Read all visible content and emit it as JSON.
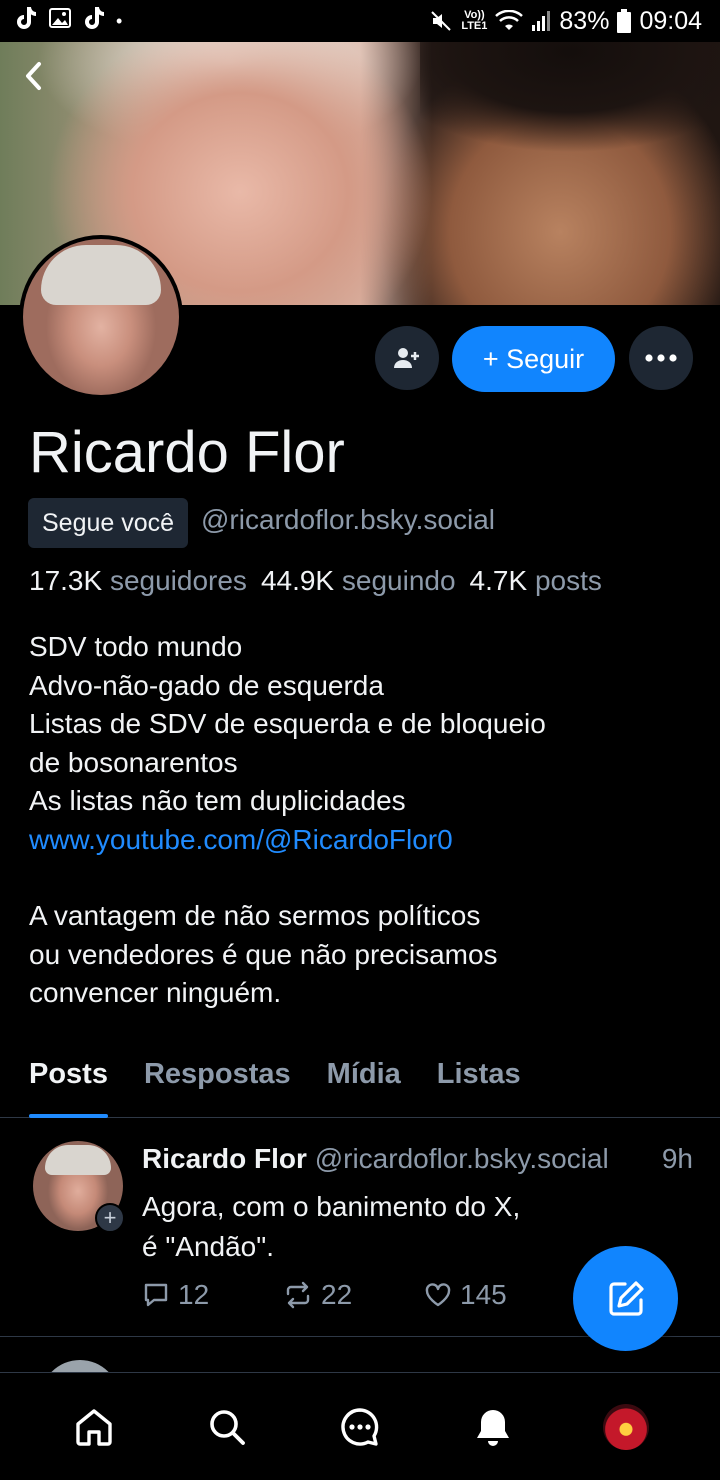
{
  "status_bar": {
    "volte_line1": "Vo))",
    "volte_line2": "LTE1",
    "battery": "83%",
    "time": "09:04"
  },
  "profile": {
    "display_name": "Ricardo Flor",
    "follows_you_badge": "Segue você",
    "handle": "@ricardoflor.bsky.social",
    "follow_button": "+ Seguir",
    "stats": {
      "followers_count": "17.3K",
      "followers_label": "seguidores",
      "following_count": "44.9K",
      "following_label": "seguindo",
      "posts_count": "4.7K",
      "posts_label": "posts"
    },
    "bio": {
      "line1": "SDV todo mundo",
      "line2": "Advo-não-gado de esquerda",
      "line3": "Listas de SDV de esquerda e de bloqueio",
      "line4": "de bosonarentos",
      "line5": "As listas não tem duplicidades",
      "link": "www.youtube.com/@RicardoFlor0",
      "para2_line1": "A vantagem de não sermos políticos",
      "para2_line2": "ou vendedores é que não precisamos",
      "para2_line3": "convencer ninguém."
    }
  },
  "tabs": [
    {
      "label": "Posts",
      "active": true
    },
    {
      "label": "Respostas",
      "active": false
    },
    {
      "label": "Mídia",
      "active": false
    },
    {
      "label": "Listas",
      "active": false
    }
  ],
  "post": {
    "author": "Ricardo Flor",
    "handle": "@ricardoflor.bsky.social",
    "time": "9h",
    "text_line1": "Agora, com o banimento do X,",
    "text_line2": "é \"Andão\".",
    "replies": "12",
    "reposts": "22",
    "likes": "145"
  },
  "colors": {
    "accent": "#1185fe",
    "link": "#208bfe",
    "muted": "#8d9aaa",
    "surface": "#1e2733"
  },
  "icons": {
    "back": "chevron-left-icon",
    "add_user": "person-add-icon",
    "more": "ellipsis-icon",
    "reply": "speech-bubble-icon",
    "repost": "repost-arrows-icon",
    "like": "heart-icon",
    "compose": "pencil-square-icon",
    "nav": [
      "home-icon",
      "search-icon",
      "chat-icon",
      "bell-icon",
      "avatar"
    ]
  }
}
